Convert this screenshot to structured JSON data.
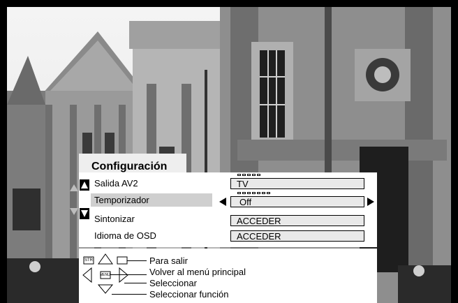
{
  "menu": {
    "title": "Configuración",
    "items": [
      {
        "label": "Salida AV2",
        "value": "TV"
      },
      {
        "label": "Temporizador",
        "value": "Off"
      },
      {
        "label": "Sintonizar",
        "value": "ACCEDER"
      },
      {
        "label": "Idioma de OSD",
        "value": "ACCEDER"
      }
    ],
    "selected_index": 1
  },
  "help": {
    "exit": "Para salir",
    "back": "Volver al menú principal",
    "select": "Seleccionar",
    "select_function": "Seleccionar función",
    "str_key": "STR",
    "menu_key": "MENU"
  },
  "icons": {
    "scroll_up": "up-triangle-icon",
    "scroll_down": "down-triangle-icon",
    "value_prev": "left-triangle-icon",
    "value_next": "right-triangle-icon"
  }
}
